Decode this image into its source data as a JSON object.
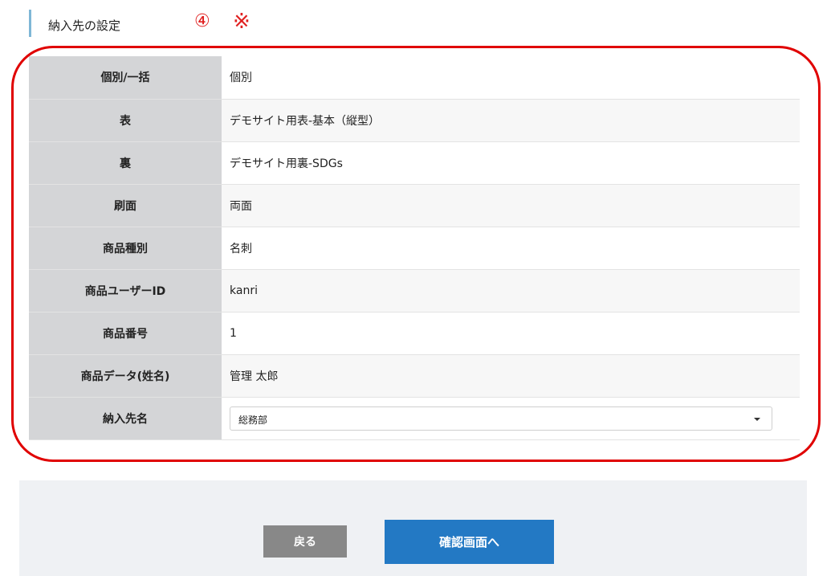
{
  "section": {
    "title": "納入先の設定",
    "annotation_number": "④",
    "annotation_mark": "※"
  },
  "rows": [
    {
      "label": "個別/一括",
      "value": "個別"
    },
    {
      "label": "表",
      "value": "デモサイト用表-基本（縦型）"
    },
    {
      "label": "裏",
      "value": "デモサイト用裏-SDGs"
    },
    {
      "label": "刷面",
      "value": "両面"
    },
    {
      "label": "商品種別",
      "value": "名刺"
    },
    {
      "label": "商品ユーザーID",
      "value": "kanri"
    },
    {
      "label": "商品番号",
      "value": "1"
    },
    {
      "label": "商品データ(姓名)",
      "value": "管理 太郎"
    }
  ],
  "destination": {
    "label": "納入先名",
    "selected": "総務部"
  },
  "buttons": {
    "back_label": "戻る",
    "confirm_label": "確認画面へ"
  },
  "colors": {
    "accent_bar": "#7fb7d6",
    "annotation_red": "#e00000",
    "confirm_button": "#2379c4",
    "back_button": "#888888",
    "label_cell": "#d4d5d7"
  }
}
